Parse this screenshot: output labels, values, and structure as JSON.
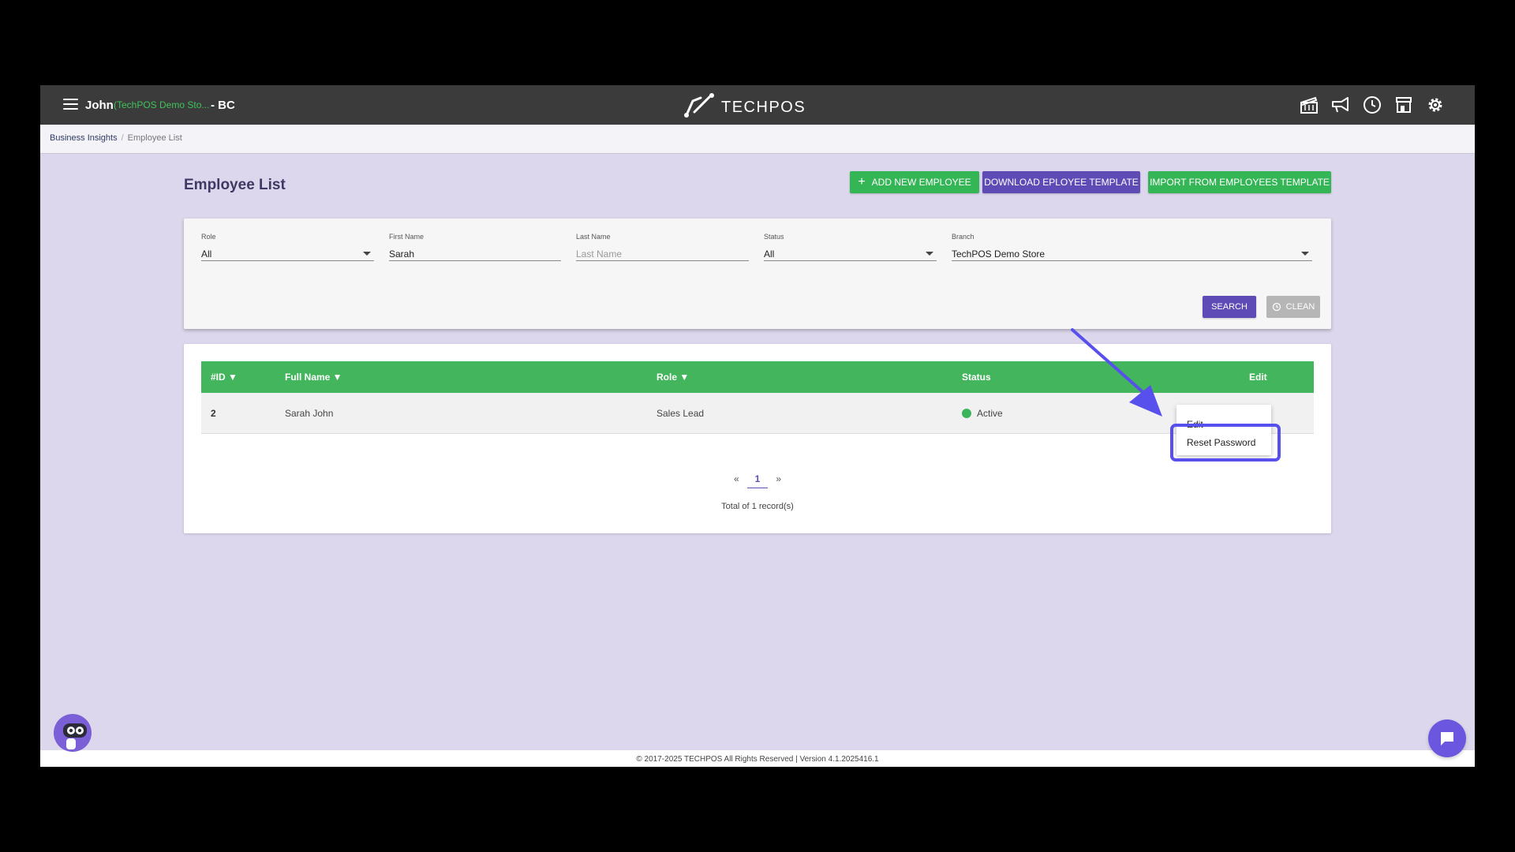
{
  "header": {
    "user_name": "John",
    "store_name": "(TechPOS Demo Sto...",
    "store_suffix": "- BC",
    "logo_text": "TECHPOS",
    "icons": [
      "clapperboard-icon",
      "megaphone-icon",
      "clock-icon",
      "store-icon",
      "gear-icon"
    ]
  },
  "breadcrumb": {
    "parent": "Business Insights",
    "separator": "/",
    "current": "Employee List"
  },
  "page": {
    "title": "Employee List"
  },
  "actions": {
    "add_plus": "+",
    "add_label": "ADD NEW EMPLOYEE",
    "download_label": "DOWNLOAD EPLOYEE TEMPLATE",
    "import_label": "IMPORT FROM EMPLOYEES TEMPLATE"
  },
  "filters": {
    "role": {
      "label": "Role",
      "value": "All"
    },
    "first_name": {
      "label": "First Name",
      "value": "Sarah"
    },
    "last_name": {
      "label": "Last Name",
      "placeholder": "Last Name"
    },
    "status": {
      "label": "Status",
      "value": "All"
    },
    "branch": {
      "label": "Branch",
      "value": "TechPOS Demo Store"
    },
    "search_label": "SEARCH",
    "clean_label": "CLEAN"
  },
  "table": {
    "columns": {
      "id": "#ID ▼",
      "full_name": "Full Name ▼",
      "role": "Role ▼",
      "status": "Status",
      "edit": "Edit"
    },
    "rows": [
      {
        "id": "2",
        "full_name": "Sarah John",
        "role": "Sales Lead",
        "status": "Active"
      }
    ]
  },
  "pagination": {
    "prev": "«",
    "current": "1",
    "next": "»",
    "total": "Total of 1 record(s)"
  },
  "row_menu": {
    "edit": "Edit",
    "reset_password": "Reset Password"
  },
  "footer": {
    "text": "© 2017-2025 TECHPOS All Rights Reserved | Version 4.1.2025416.1"
  },
  "colors": {
    "accent_green": "#34b556",
    "accent_purple": "#5f4bb6",
    "highlight": "#5850ec",
    "background": "#dcd7ec"
  }
}
